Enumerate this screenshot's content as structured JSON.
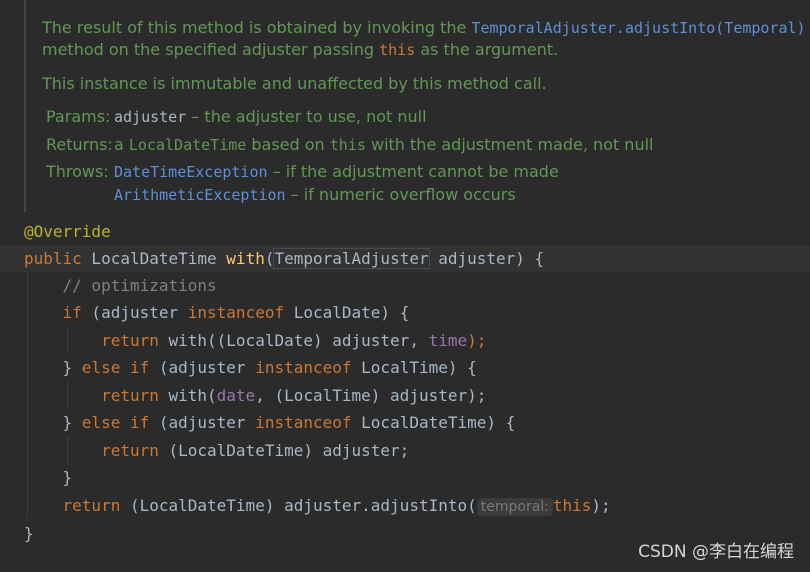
{
  "javadoc": {
    "p1_line1_a": "The result of this method is obtained by invoking the ",
    "p1_line1_link": "TemporalAdjuster.adjustInto(Temporal)",
    "p1_line2_a": "method on the specified adjuster passing ",
    "p1_line2_code": "this",
    "p1_line2_b": " as the argument.",
    "p2": "This instance is immutable and unaffected by this method call.",
    "params_label": "Params:",
    "params_name": "adjuster",
    "params_desc": " – the adjuster to use, not null",
    "returns_label": "Returns:",
    "returns_a": "a ",
    "returns_code": "LocalDateTime",
    "returns_b": " based on ",
    "returns_code2": "this",
    "returns_c": " with the adjustment made, not null",
    "throws_label": "Throws:",
    "throws1_code": "DateTimeException",
    "throws1_desc": " – if the adjustment cannot be made",
    "throws2_code": "ArithmeticException",
    "throws2_desc": " – if numeric overflow occurs"
  },
  "code": {
    "annotation": "@Override",
    "sig_public": "public",
    "sig_type": " LocalDateTime ",
    "sig_name": "with",
    "sig_open": "(",
    "sig_param_type": "TemporalAdjuster",
    "sig_param_rest": " adjuster) {",
    "comment": "// optimizations",
    "if1_kw": "if",
    "if1_a": " (adjuster ",
    "instanceof": "instanceof",
    "if1_b": " LocalDate) {",
    "ret": "return",
    "r1_a": " with((LocalDate) adjuster, ",
    "r1_field": "time",
    "r1_end": ");",
    "else_close": "} ",
    "else_if": "else if",
    "if2_a": " (adjuster ",
    "if2_b": " LocalTime) {",
    "r2_a": " with(",
    "r2_field": "date",
    "r2_b": ", (LocalTime) adjuster);",
    "if3_b": " LocalDateTime) {",
    "r3_a": " (LocalDateTime) adjuster;",
    "close_brace": "}",
    "final_a": " (LocalDateTime) adjuster.adjustInto(",
    "hint": "temporal:",
    "final_this": "this",
    "final_end": ");",
    "method_close": "}"
  },
  "watermark": "CSDN @李白在编程"
}
